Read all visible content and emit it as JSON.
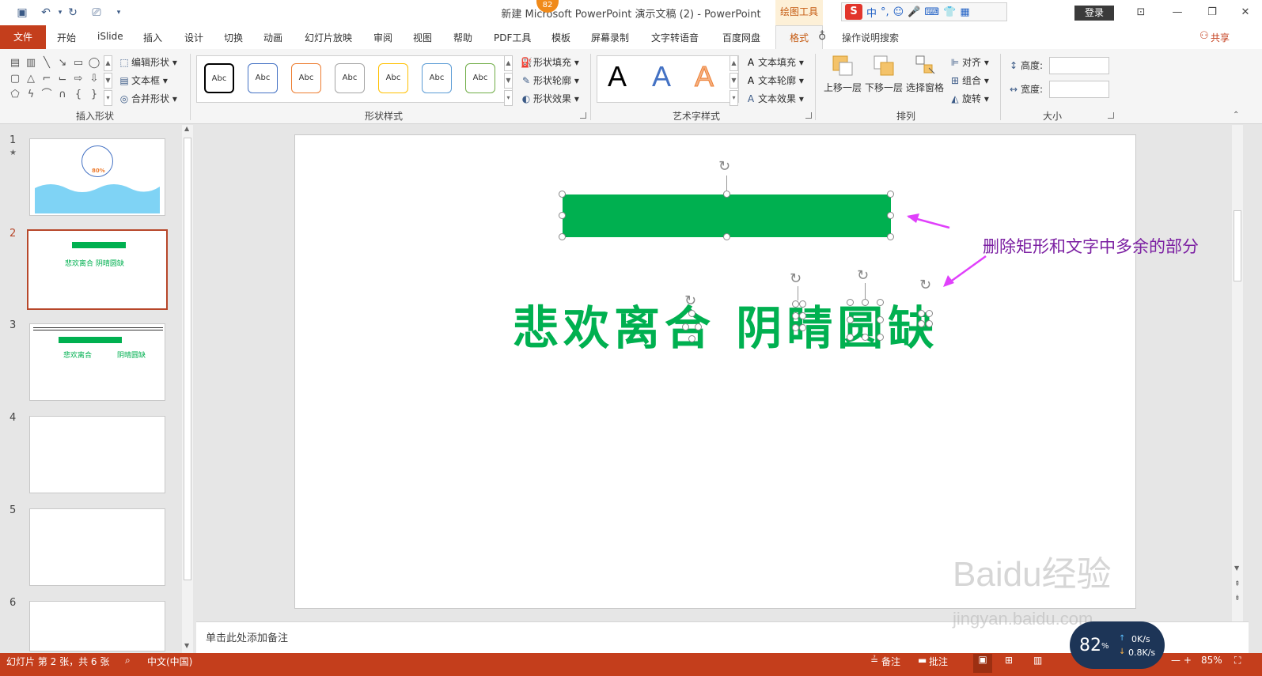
{
  "window": {
    "title": "新建 Microsoft PowerPoint 演示文稿 (2)  -  PowerPoint",
    "context_tab": "绘图工具",
    "notification_badge": "82",
    "login_label": "登录"
  },
  "ime_bar": {
    "logo": "S",
    "items": [
      "中",
      "°,",
      "☺",
      "🎤",
      "⌨",
      "👕",
      "▦"
    ]
  },
  "tabs": {
    "file": "文件",
    "items": [
      "开始",
      "iSlide",
      "插入",
      "设计",
      "切换",
      "动画",
      "幻灯片放映",
      "审阅",
      "视图",
      "帮助",
      "PDF工具",
      "模板",
      "屏幕录制",
      "文字转语音",
      "百度网盘"
    ],
    "active": "格式",
    "tell_me": "操作说明搜索",
    "share": "共享"
  },
  "ribbon": {
    "insert_shapes": {
      "label": "插入形状",
      "edit_shape": "编辑形状",
      "text_box": "文本框",
      "merge_shapes": "合并形状"
    },
    "shape_styles": {
      "label": "形状样式",
      "swatch_text": "Abc",
      "swatch_colors": [
        "#000000",
        "#4472c4",
        "#ed7d31",
        "#a5a5a5",
        "#ffc000",
        "#5b9bd5",
        "#70ad47"
      ],
      "fill": "形状填充",
      "outline": "形状轮廓",
      "effects": "形状效果"
    },
    "wordart": {
      "label": "艺术字样式",
      "letters": [
        "A",
        "A",
        "A"
      ],
      "text_fill": "文本填充",
      "text_outline": "文本轮廓",
      "text_effects": "文本效果"
    },
    "arrange": {
      "label": "排列",
      "bring_forward": "上移一层",
      "send_backward": "下移一层",
      "selection_pane": "选择窗格",
      "align": "对齐",
      "group": "组合",
      "rotate": "旋转"
    },
    "size": {
      "label": "大小",
      "height_label": "高度:",
      "width_label": "宽度:",
      "height_value": "",
      "width_value": ""
    }
  },
  "thumbnails": [
    {
      "number": "1",
      "star": "★",
      "ring_label": "80%"
    },
    {
      "number": "2",
      "title": "悲欢离合 阴晴圆缺"
    },
    {
      "number": "3",
      "title_left": "悲欢离合",
      "title_right": "阴晴圆缺"
    },
    {
      "number": "4"
    },
    {
      "number": "5"
    },
    {
      "number": "6"
    }
  ],
  "slide": {
    "text": "悲欢离合 阴晴圆缺",
    "annotation": "删除矩形和文字中多余的部分",
    "rect_color": "#00b050",
    "annotation_color": "#7b1fa2"
  },
  "notes_placeholder": "单击此处添加备注",
  "status": {
    "slide_info": "幻灯片 第 2 张，共 6 张",
    "language": "中文(中国)",
    "notes": "备注",
    "comments": "批注",
    "zoom": "85%"
  },
  "net_widget": {
    "percent": "82",
    "up": "0K/s",
    "down": "0.8K/s"
  },
  "watermark": {
    "logo": "Baidu经验",
    "url": "jingyan.baidu.com"
  }
}
